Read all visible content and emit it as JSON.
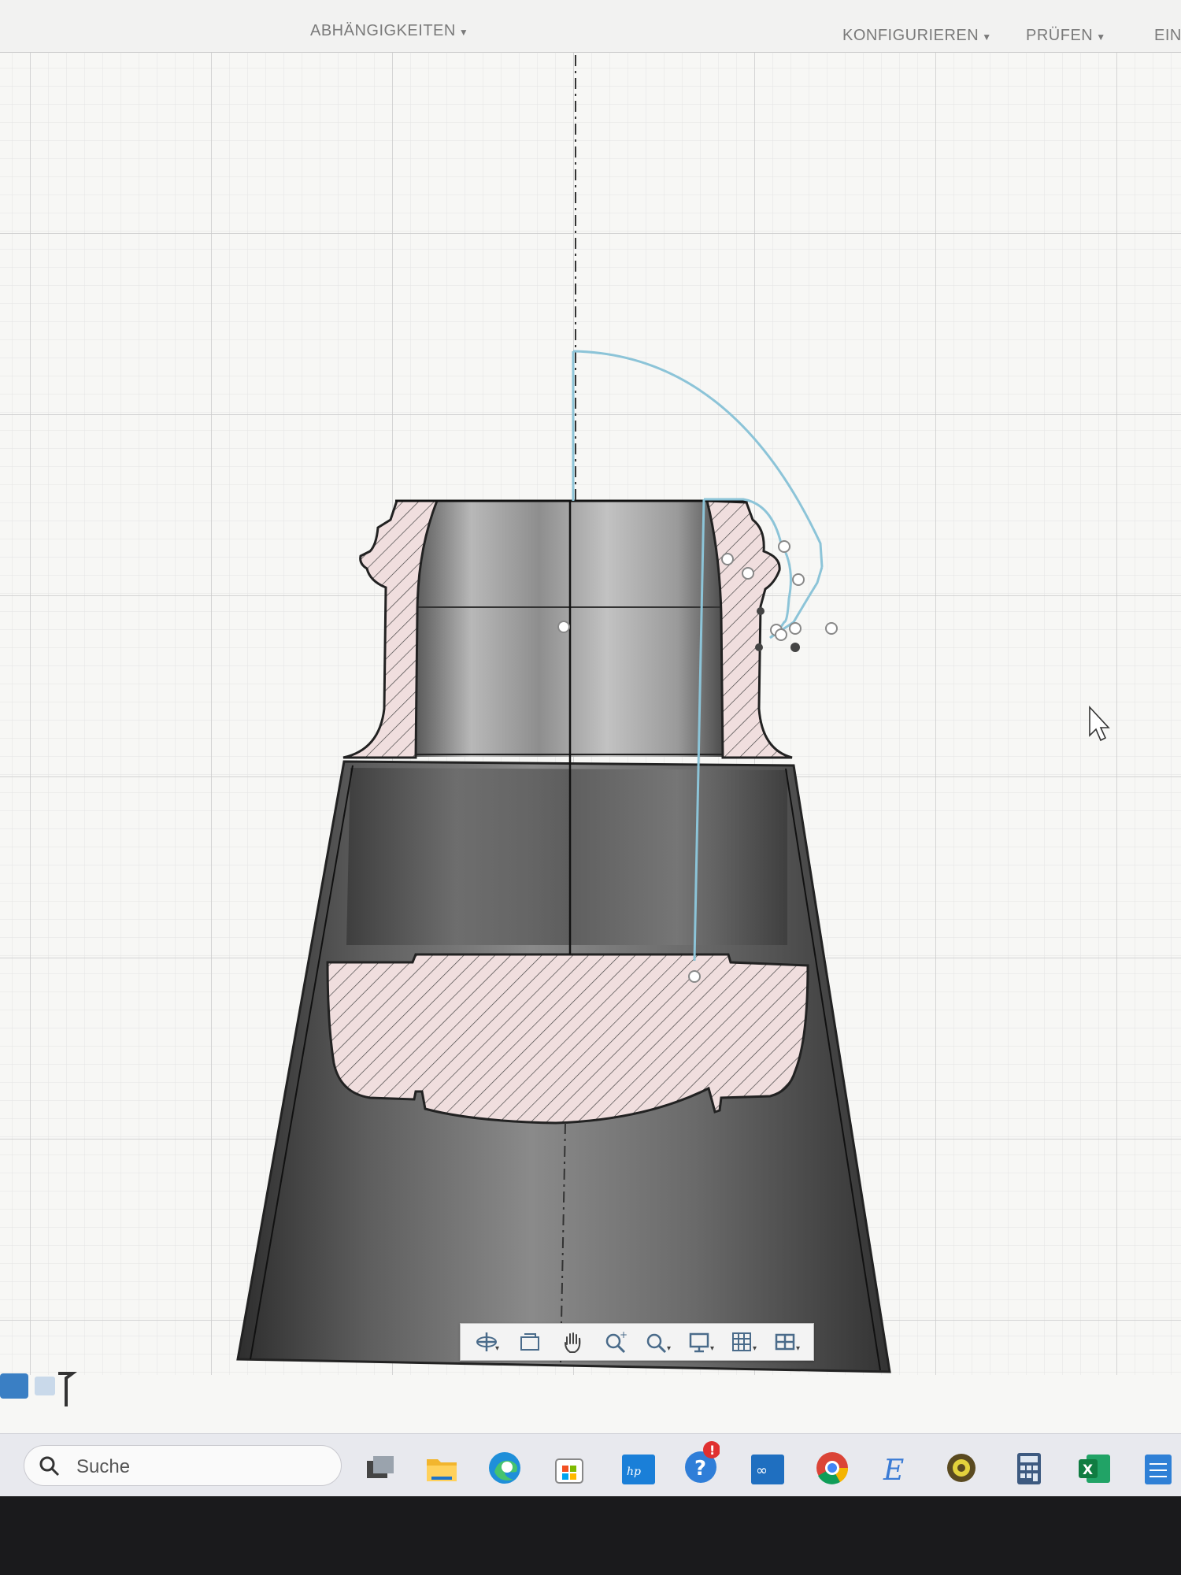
{
  "toolbar": {
    "abhaengigkeiten": "ABHÄNGIGKEITEN",
    "konfigurieren": "KONFIGURIEREN",
    "pruefen": "PRÜFEN",
    "einfuegen": "EIN"
  },
  "taskbar": {
    "search_placeholder": "Suche"
  },
  "icons": {
    "nav": [
      "orbit-icon",
      "look-at-icon",
      "pan-icon",
      "zoom-icon",
      "zoom-window-icon",
      "display-settings-icon",
      "grid-settings-icon",
      "viewports-icon"
    ],
    "apps": [
      "task-view-icon",
      "file-explorer-icon",
      "edge-icon",
      "store-icon",
      "myhp-icon",
      "help-icon",
      "arduino-icon",
      "chrome-icon",
      "e-app-icon",
      "settings-icon",
      "calculator-icon",
      "excel-icon",
      "notepad-icon"
    ]
  },
  "colors": {
    "hatch_fill": "#f0dede",
    "sketch_line": "#8cc4d8",
    "grid": "#dcdcdc"
  }
}
